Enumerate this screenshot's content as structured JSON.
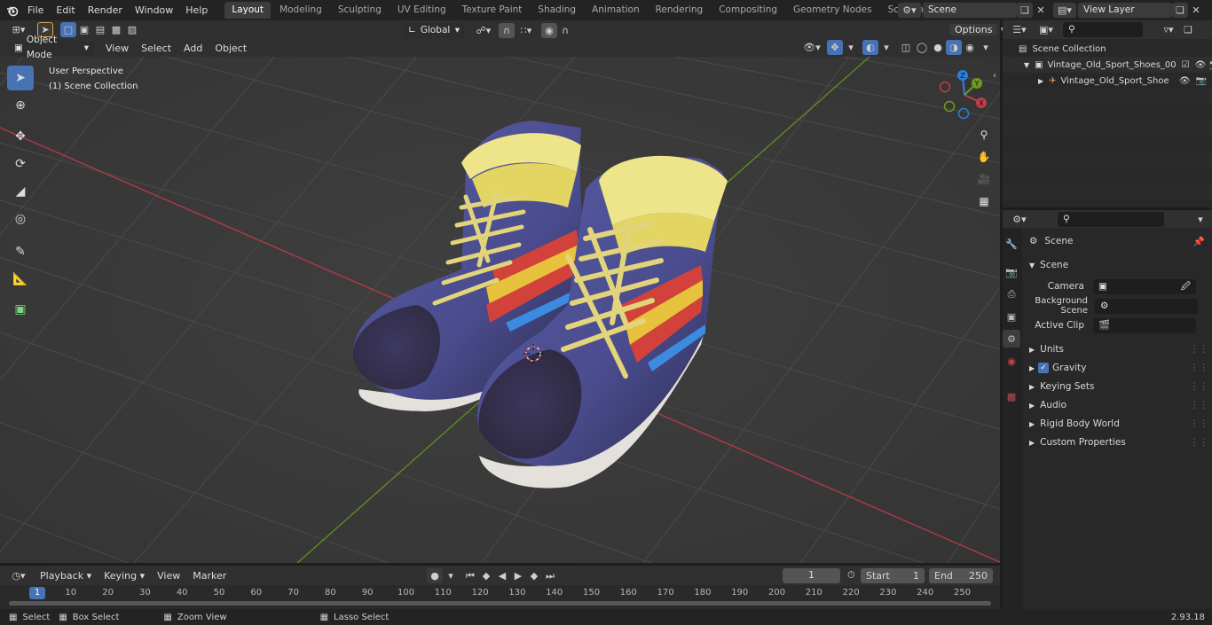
{
  "topbar": {
    "menus": [
      "File",
      "Edit",
      "Render",
      "Window",
      "Help"
    ],
    "workspaces": [
      "Layout",
      "Modeling",
      "Sculpting",
      "UV Editing",
      "Texture Paint",
      "Shading",
      "Animation",
      "Rendering",
      "Compositing",
      "Geometry Nodes",
      "Scripting"
    ],
    "add_tab": "+",
    "scene_name": "Scene",
    "view_layer": "View Layer"
  },
  "vp_header": {
    "mode": "Object Mode",
    "menus": [
      "View",
      "Select",
      "Add",
      "Object"
    ],
    "orientation": "Global",
    "options": "Options"
  },
  "viewport": {
    "perspective": "User Perspective",
    "collection": "(1) Scene Collection",
    "gizmo": {
      "x": "X",
      "y": "Y",
      "z": "Z"
    }
  },
  "outliner": {
    "root": "Scene Collection",
    "collection": "Vintage_Old_Sport_Shoes_00",
    "object": "Vintage_Old_Sport_Shoe"
  },
  "properties": {
    "header": "Scene",
    "section": "Scene",
    "fields": [
      {
        "label": "Camera",
        "value": ""
      },
      {
        "label": "Background Scene",
        "value": ""
      },
      {
        "label": "Active Clip",
        "value": ""
      }
    ],
    "panels": [
      "Units",
      "Gravity",
      "Keying Sets",
      "Audio",
      "Rigid Body World",
      "Custom Properties"
    ],
    "gravity_checked": true
  },
  "timeline": {
    "menus": [
      "Playback",
      "Keying",
      "View",
      "Marker"
    ],
    "current_frame": "1",
    "start_label": "Start",
    "start": "1",
    "end_label": "End",
    "end": "250",
    "ruler": [
      "1",
      "10",
      "20",
      "30",
      "40",
      "50",
      "60",
      "70",
      "80",
      "90",
      "100",
      "110",
      "120",
      "130",
      "140",
      "150",
      "160",
      "170",
      "180",
      "190",
      "200",
      "210",
      "220",
      "230",
      "240",
      "250"
    ]
  },
  "statusbar": {
    "select": "Select",
    "box_select": "Box Select",
    "zoom_view": "Zoom View",
    "lasso_select": "Lasso Select",
    "version": "2.93.18"
  },
  "colors": {
    "accent": "#4772b3",
    "x_axis": "#c23d4a",
    "y_axis": "#6b9a1e",
    "z_axis": "#2d7fd8",
    "shoe_body": "#4e4f8f",
    "shoe_stripe_red": "#d2413a",
    "shoe_stripe_yellow": "#e8c23c",
    "laces": "#e6d77a"
  }
}
